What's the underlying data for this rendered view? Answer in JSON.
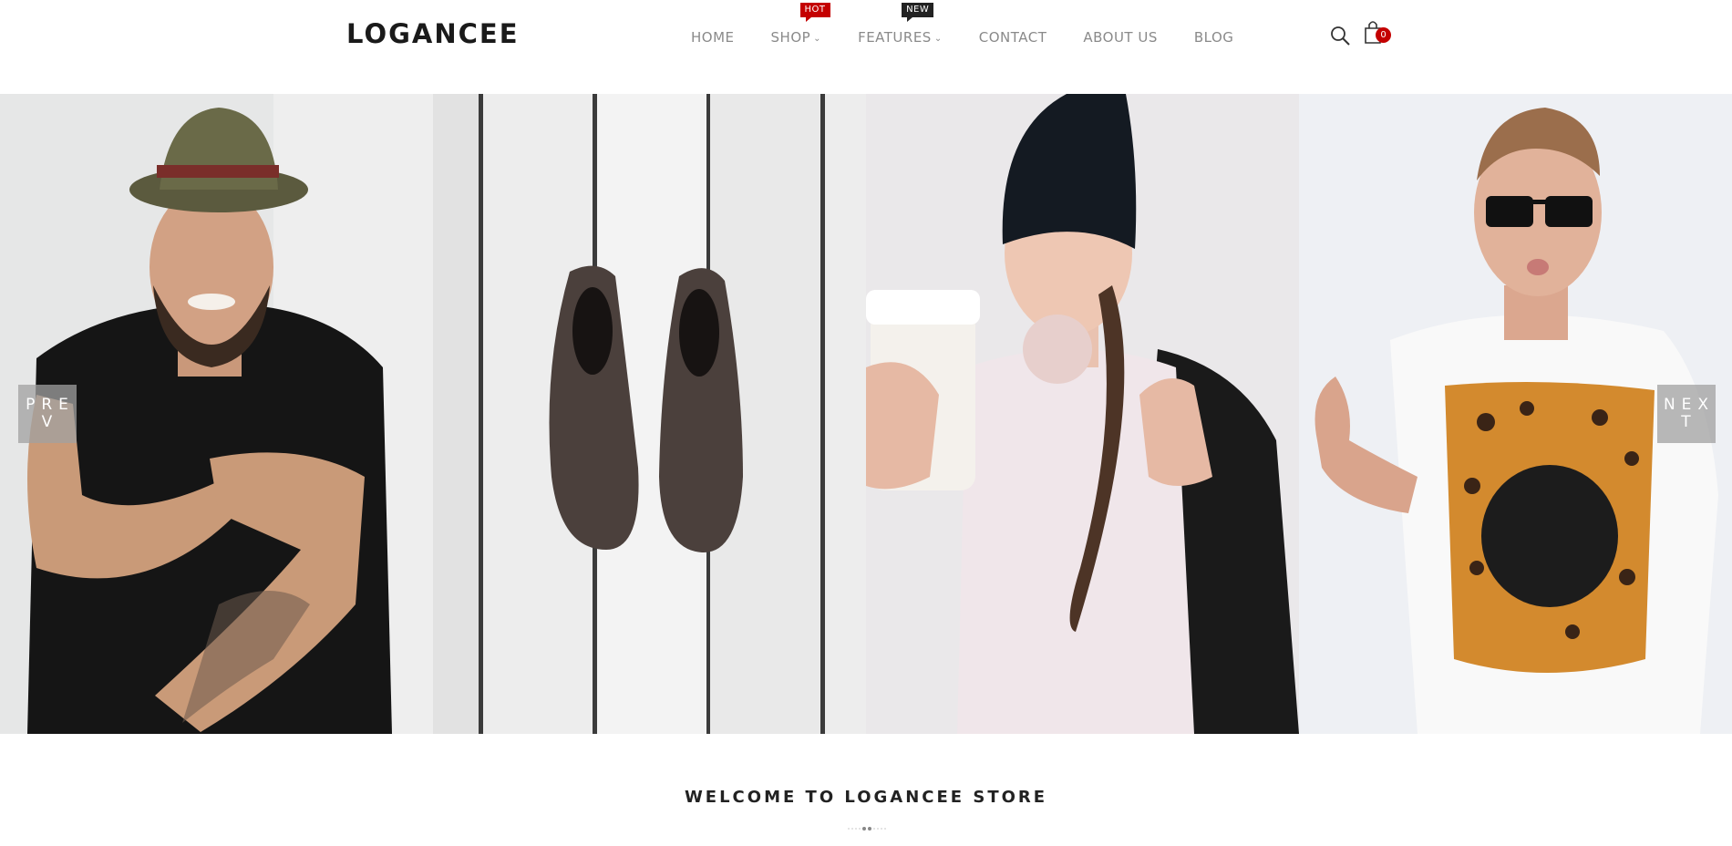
{
  "brand": {
    "logo": "LOGANCEE"
  },
  "nav": {
    "items": [
      {
        "label": "HOME",
        "has_dropdown": false
      },
      {
        "label": "SHOP",
        "has_dropdown": true,
        "badge": "HOT"
      },
      {
        "label": "FEATURES",
        "has_dropdown": true,
        "badge": "NEW"
      },
      {
        "label": "CONTACT",
        "has_dropdown": false
      },
      {
        "label": "ABOUT US",
        "has_dropdown": false
      },
      {
        "label": "BLOG",
        "has_dropdown": false
      }
    ]
  },
  "header_icons": {
    "search": "search-icon",
    "cart": "shopping-bag-icon",
    "cart_count": "0"
  },
  "slider": {
    "prev_label": "PREV",
    "next_label": "NEXT",
    "slides": [
      {
        "subject": "man-in-fedora-photo"
      },
      {
        "subject": "leather-shoes-photo"
      },
      {
        "subject": "woman-in-beanie-photo"
      },
      {
        "subject": "man-in-sunglasses-photo"
      }
    ]
  },
  "welcome": {
    "title": "WELCOME TO LOGANCEE STORE"
  },
  "colors": {
    "accent": "#c40000",
    "badge_new": "#222222",
    "nav_text": "#8a8a8a"
  }
}
